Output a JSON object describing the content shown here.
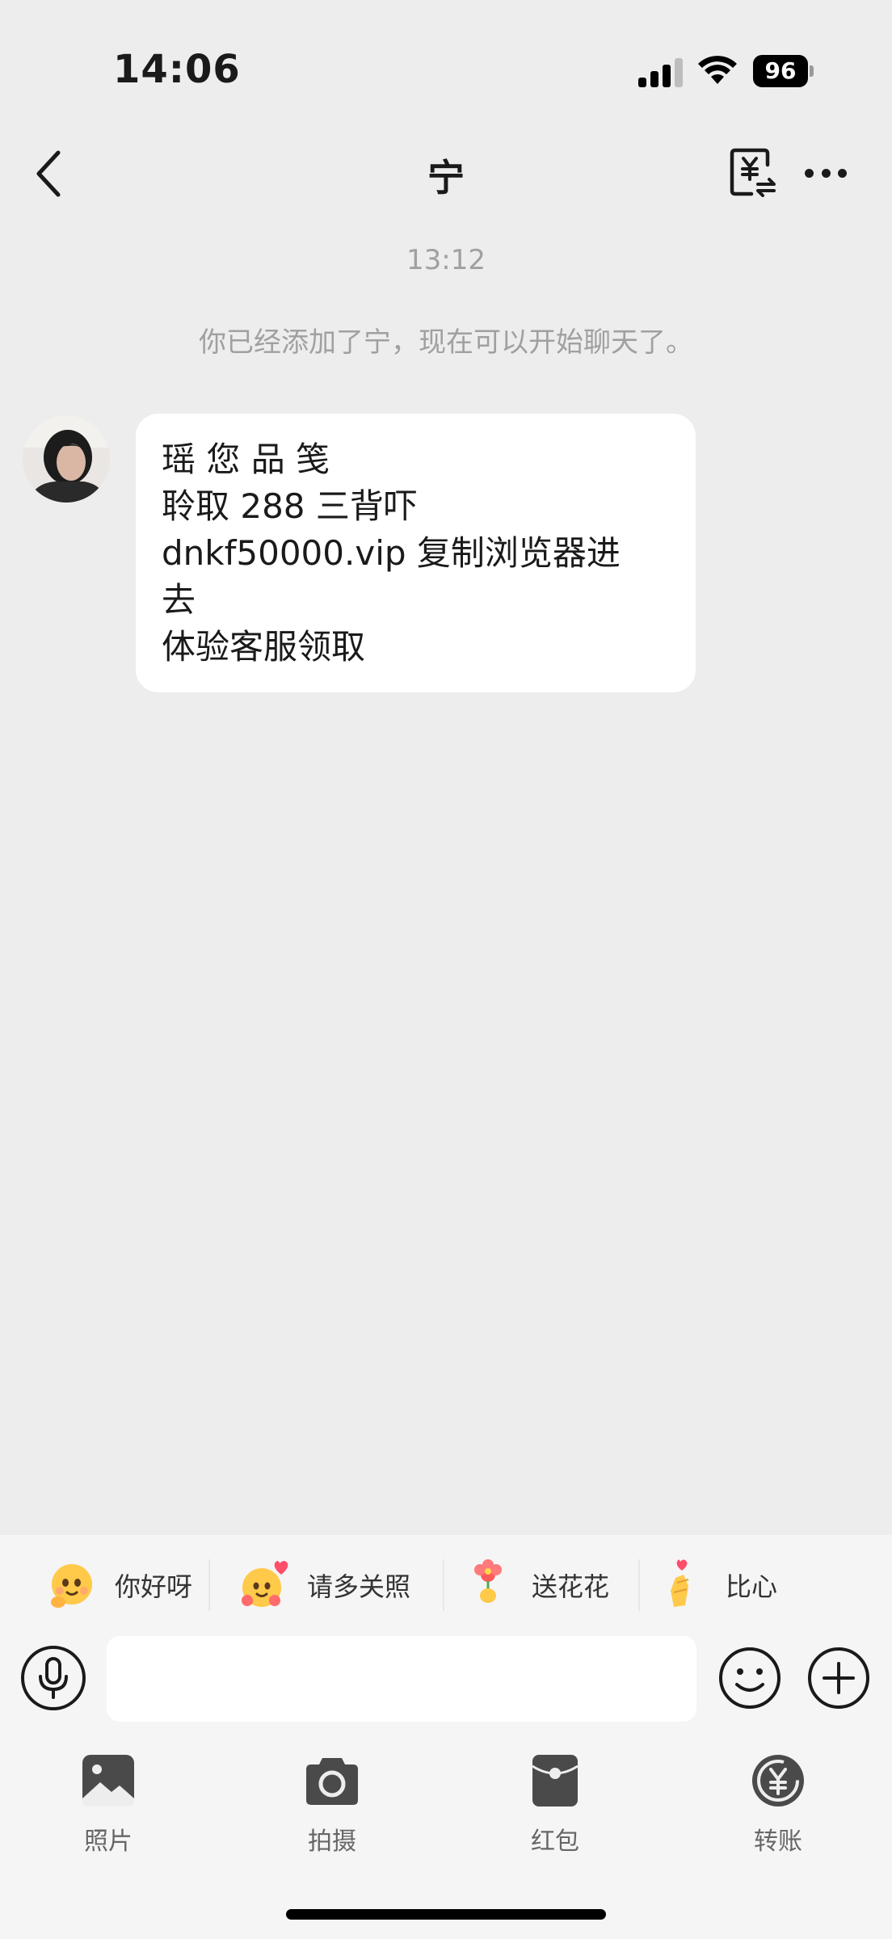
{
  "status_bar": {
    "time": "14:06",
    "battery": "96"
  },
  "nav": {
    "title": "宁"
  },
  "chat": {
    "timestamp": "13:12",
    "system_message": "你已经添加了宁，现在可以开始聊天了。",
    "messages": [
      {
        "sender": "宁",
        "lines": [
          "瑶 您 品 笺",
          "聆取 288 三背吓",
          "dnkf50000.vip 复制浏览器进",
          "去",
          "体验客服领取"
        ]
      }
    ]
  },
  "quick_replies": [
    {
      "label": "你好呀",
      "icon": "greeting-emoji-icon"
    },
    {
      "label": "请多关照",
      "icon": "hug-heart-emoji-icon"
    },
    {
      "label": "送花花",
      "icon": "flower-emoji-icon"
    },
    {
      "label": "比心",
      "icon": "finger-heart-emoji-icon"
    }
  ],
  "input": {
    "placeholder": ""
  },
  "toolbar": [
    {
      "label": "照片",
      "icon": "photo-icon"
    },
    {
      "label": "拍摄",
      "icon": "camera-icon"
    },
    {
      "label": "红包",
      "icon": "red-packet-icon"
    },
    {
      "label": "转账",
      "icon": "transfer-yuan-icon"
    }
  ],
  "colors": {
    "background": "#ededed",
    "bubble": "#ffffff",
    "accent_text": "#1a1a1a",
    "muted_text": "#a0a0a0"
  }
}
